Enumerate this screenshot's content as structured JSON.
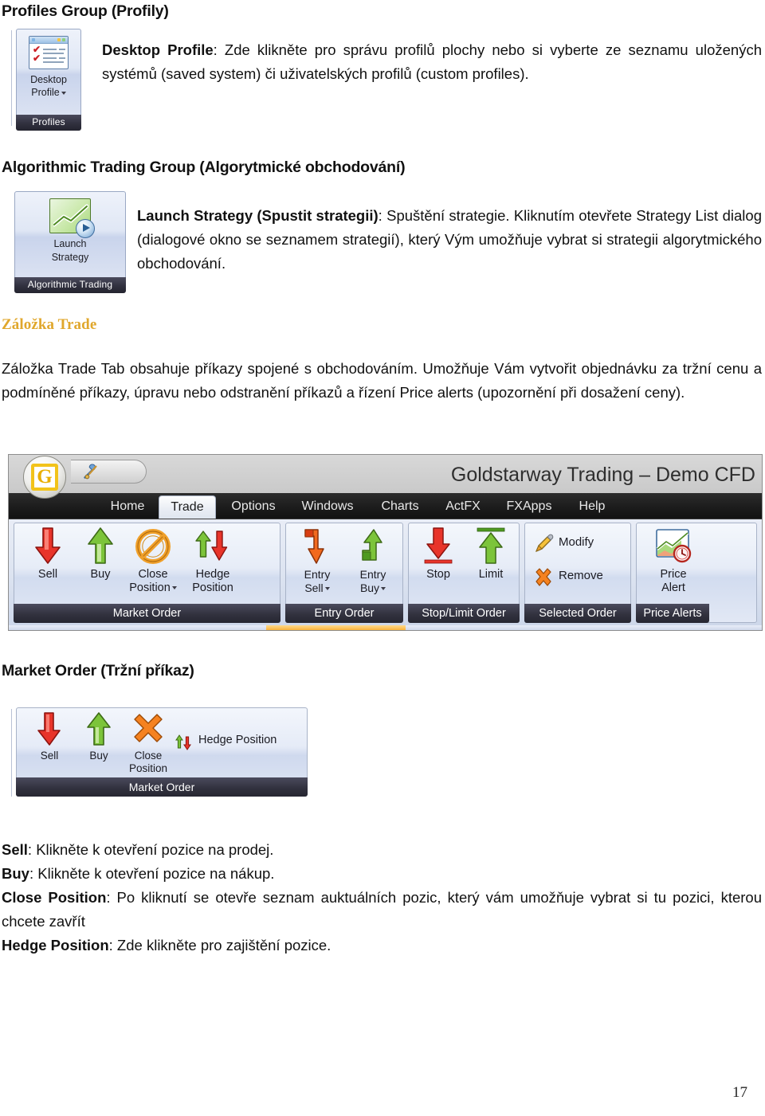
{
  "document": {
    "page_number": "17",
    "sections": [
      {
        "heading": "Profiles Group (Profily)",
        "paragraph_lead": "Desktop Profile",
        "paragraph_rest": ": Zde klikněte pro správu profilů plochy nebo si vyberte ze seznamu uložených systémů (saved system) či uživatelských profilů (custom profiles)."
      },
      {
        "heading": "Algorithmic Trading Group (Algorytmické obchodování)",
        "paragraph_lead": "Launch Strategy (Spustit strategii)",
        "paragraph_rest": ": Spuštění strategie. Kliknutím otevřete Strategy List dialog (dialogové okno se seznamem strategií), který Vým umožňuje vybrat si strategii algorytmického obchodování."
      }
    ],
    "trade_tab": {
      "heading": "Záložka Trade",
      "heading_color": "#e0a72c",
      "paragraph": "Záložka Trade Tab obsahuje příkazy spojené s obchodováním. Umožňuje Vám vytvořit objednávku za tržní cenu a podmíněné příkazy, úpravu nebo odstranění příkazů a řízení Price alerts (upozornění při dosažení ceny)."
    },
    "market_order_section": {
      "heading": "Market Order (Tržní příkaz)",
      "definitions": [
        {
          "term": "Sell",
          "desc": ": Klikněte k otevření pozice na prodej."
        },
        {
          "term": "Buy",
          "desc": ": Klikněte k otevření pozice na nákup."
        },
        {
          "term": "Close Position",
          "desc": ": Po kliknutí se otevře seznam auktuálních pozic, který vám umožňuje vybrat si tu pozici, kterou chcete zavřít"
        },
        {
          "term": "Hedge Position",
          "desc": ": Zde klikněte pro zajištění pozice."
        }
      ]
    }
  },
  "figure_profiles": {
    "button_label_line1": "Desktop",
    "button_label_line2": "Profile",
    "group_caption": "Profiles",
    "icon": "desktop-profile-window-icon"
  },
  "figure_algo": {
    "button_label_line1": "Launch",
    "button_label_line2": "Strategy",
    "group_caption": "Algorithmic Trading",
    "icon": "chart-with-play-icon"
  },
  "figure_ribbon": {
    "app_title": "Goldstarway Trading – Demo CFD",
    "office_orb_letter": "G",
    "quick_access_icon": "tools-icon",
    "tabs": [
      {
        "label": "Home",
        "active": false
      },
      {
        "label": "Trade",
        "active": true
      },
      {
        "label": "Options",
        "active": false
      },
      {
        "label": "Windows",
        "active": false
      },
      {
        "label": "Charts",
        "active": false
      },
      {
        "label": "ActFX",
        "active": false
      },
      {
        "label": "FXApps",
        "active": false
      },
      {
        "label": "Help",
        "active": false
      }
    ],
    "groups": [
      {
        "caption": "Market Order",
        "buttons": [
          {
            "label1": "Sell",
            "label2": "",
            "icon": "red-down-arrow-icon",
            "dropdown": false
          },
          {
            "label1": "Buy",
            "label2": "",
            "icon": "green-up-arrow-icon",
            "dropdown": false
          },
          {
            "label1": "Close",
            "label2": "Position",
            "icon": "orange-no-entry-icon",
            "dropdown": true
          },
          {
            "label1": "Hedge",
            "label2": "Position",
            "icon": "up-down-arrows-icon",
            "dropdown": false
          }
        ]
      },
      {
        "caption": "Entry Order",
        "buttons": [
          {
            "label1": "Entry",
            "label2": "Sell",
            "icon": "entry-sell-bent-arrow-icon",
            "dropdown": true
          },
          {
            "label1": "Entry",
            "label2": "Buy",
            "icon": "entry-buy-bent-arrow-icon",
            "dropdown": true
          }
        ]
      },
      {
        "caption": "Stop/Limit Order",
        "buttons": [
          {
            "label1": "Stop",
            "label2": "",
            "icon": "stop-down-arrow-line-icon",
            "dropdown": false
          },
          {
            "label1": "Limit",
            "label2": "",
            "icon": "limit-up-arrow-line-icon",
            "dropdown": false
          }
        ]
      },
      {
        "caption": "Selected Order",
        "buttons": [
          {
            "label1": "Modify",
            "label2": "",
            "icon": "pencil-icon",
            "dropdown": false
          },
          {
            "label1": "Remove",
            "label2": "",
            "icon": "orange-x-icon",
            "dropdown": false
          }
        ]
      },
      {
        "caption": "Price Alerts",
        "buttons": [
          {
            "label1": "Price",
            "label2": "Alert",
            "icon": "chart-with-clock-icon",
            "dropdown": false
          }
        ]
      }
    ]
  },
  "figure_market_order": {
    "caption": "Market Order",
    "buttons": [
      {
        "label1": "Sell",
        "label2": "",
        "icon": "red-down-arrow-icon"
      },
      {
        "label1": "Buy",
        "label2": "",
        "icon": "green-up-arrow-icon"
      },
      {
        "label1": "Close",
        "label2": "Position",
        "icon": "orange-x-icon"
      }
    ],
    "hedge_label": "Hedge Position",
    "hedge_icon": "up-down-arrows-small-icon"
  }
}
